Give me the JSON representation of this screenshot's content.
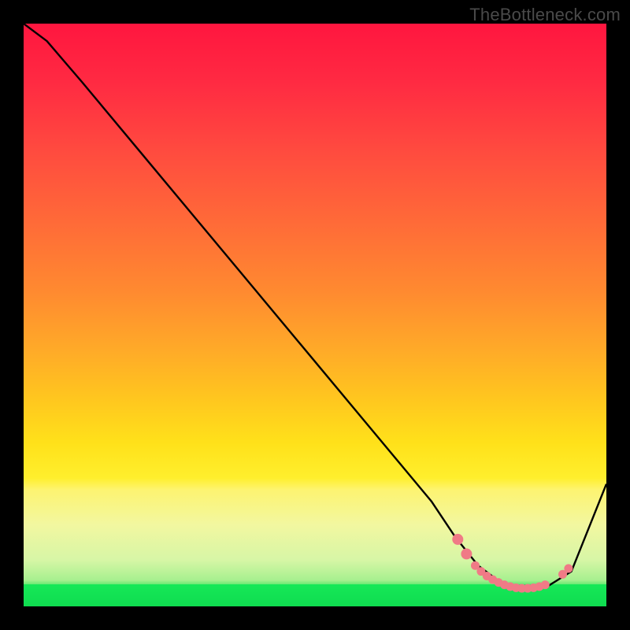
{
  "watermark": "TheBottleneck.com",
  "chart_data": {
    "type": "line",
    "title": "",
    "xlabel": "",
    "ylabel": "",
    "xlim": [
      0,
      100
    ],
    "ylim": [
      0,
      100
    ],
    "series": [
      {
        "name": "curve",
        "color": "#000000",
        "x": [
          0,
          4,
          7,
          10,
          20,
          30,
          40,
          50,
          60,
          65,
          70,
          74,
          78,
          82,
          86,
          90,
          94,
          100
        ],
        "y": [
          100,
          97,
          93.5,
          90,
          78,
          66,
          54,
          42,
          30,
          24,
          18,
          12,
          7,
          4,
          3,
          3.5,
          6,
          21
        ]
      }
    ],
    "markers": {
      "name": "bottom-cluster",
      "color": "#f07a86",
      "radius_small": 5.5,
      "radius_large": 7,
      "points": [
        {
          "x": 74.5,
          "y": 11.5,
          "r": "large"
        },
        {
          "x": 76,
          "y": 9.0,
          "r": "large"
        },
        {
          "x": 77.5,
          "y": 7.0,
          "r": "small"
        },
        {
          "x": 78.5,
          "y": 6.0,
          "r": "small"
        },
        {
          "x": 79.5,
          "y": 5.2,
          "r": "small"
        },
        {
          "x": 80.5,
          "y": 4.6,
          "r": "small"
        },
        {
          "x": 81.5,
          "y": 4.1,
          "r": "small"
        },
        {
          "x": 82.5,
          "y": 3.7,
          "r": "small"
        },
        {
          "x": 83.5,
          "y": 3.4,
          "r": "small"
        },
        {
          "x": 84.5,
          "y": 3.2,
          "r": "small"
        },
        {
          "x": 85.5,
          "y": 3.1,
          "r": "small"
        },
        {
          "x": 86.5,
          "y": 3.1,
          "r": "small"
        },
        {
          "x": 87.5,
          "y": 3.2,
          "r": "small"
        },
        {
          "x": 88.5,
          "y": 3.4,
          "r": "small"
        },
        {
          "x": 89.5,
          "y": 3.7,
          "r": "small"
        },
        {
          "x": 92.5,
          "y": 5.5,
          "r": "small"
        },
        {
          "x": 93.5,
          "y": 6.5,
          "r": "small"
        }
      ]
    },
    "background_gradient": {
      "type": "vertical",
      "stops": [
        {
          "pos": 0.0,
          "color": "#ff163f"
        },
        {
          "pos": 0.35,
          "color": "#ff6a38"
        },
        {
          "pos": 0.65,
          "color": "#ffc51f"
        },
        {
          "pos": 0.8,
          "color": "#fdf471"
        },
        {
          "pos": 0.93,
          "color": "#b9f39a"
        },
        {
          "pos": 0.965,
          "color": "#16e857"
        },
        {
          "pos": 1.0,
          "color": "#0fdc50"
        }
      ]
    }
  }
}
